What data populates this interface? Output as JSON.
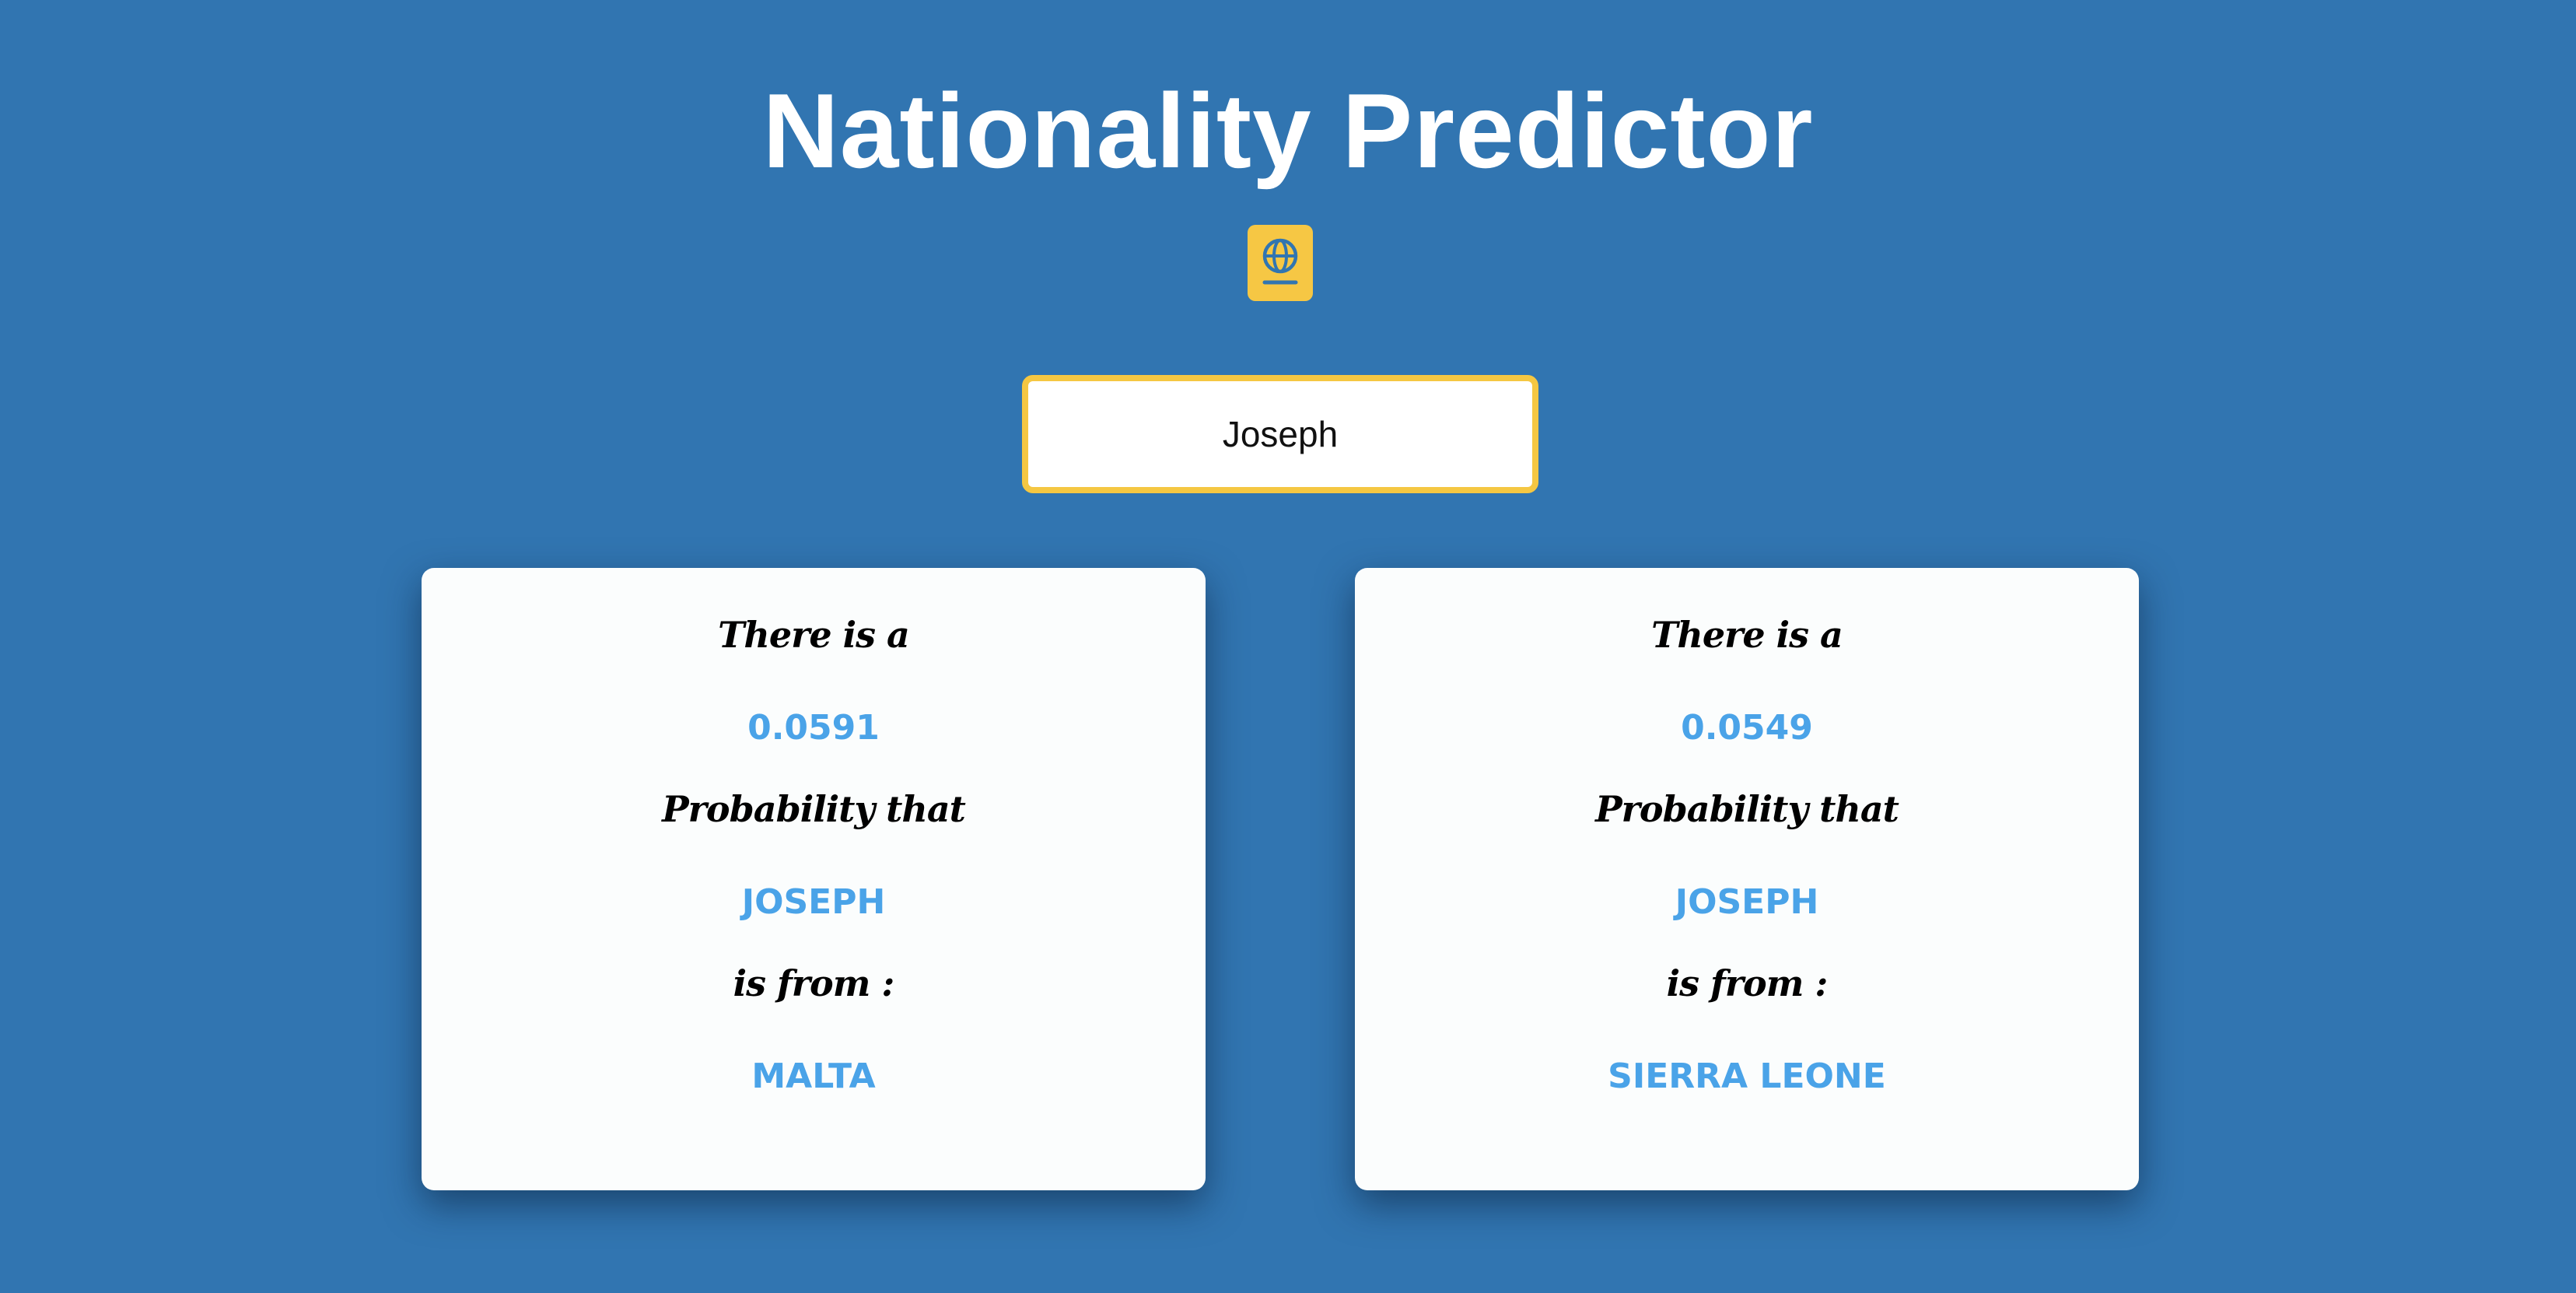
{
  "title": "Nationality Predictor",
  "icon": "passport-globe-icon",
  "search": {
    "value": "Joseph"
  },
  "colors": {
    "background": "#3175b1",
    "accent_yellow": "#f5c742",
    "value_blue": "#4aa3e8",
    "card": "#fbfdfd"
  },
  "results": [
    {
      "intro": "There is a",
      "probability": "0.0591",
      "probability_label": "Probability that",
      "name": "Joseph",
      "from_label": "is from :",
      "country": "Malta"
    },
    {
      "intro": "There is a",
      "probability": "0.0549",
      "probability_label": "Probability that",
      "name": "Joseph",
      "from_label": "is from :",
      "country": "Sierra Leone"
    }
  ]
}
